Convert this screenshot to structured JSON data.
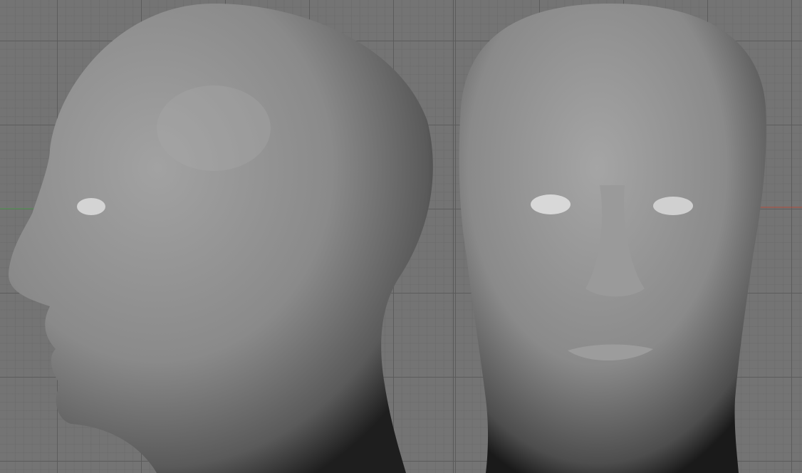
{
  "viewports": [
    {
      "view": "side",
      "axis_color": "#4f9a4f"
    },
    {
      "view": "front",
      "axis_color": "#b04a3a"
    }
  ],
  "colors": {
    "background": "#747474",
    "mesh": "#8a8a8a",
    "grid": "#5a5a5a"
  }
}
